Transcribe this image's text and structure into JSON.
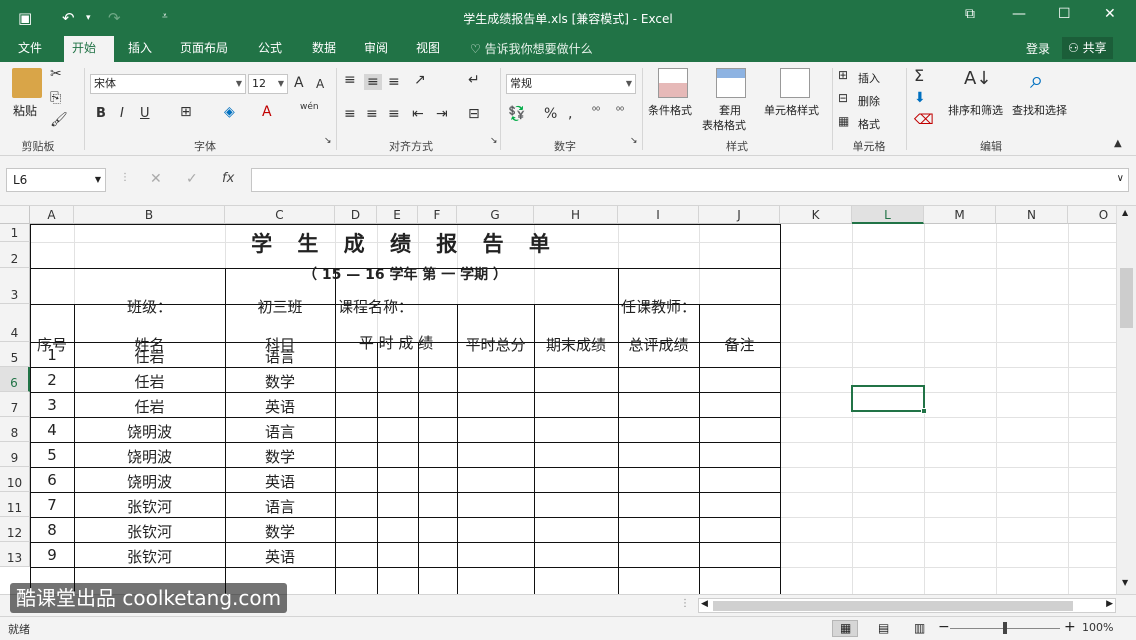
{
  "window": {
    "title": "学生成绩报告单.xls  [兼容模式] - Excel"
  },
  "tabs": {
    "file": "文件",
    "home": "开始",
    "insert": "插入",
    "page_layout": "页面布局",
    "formulas": "公式",
    "data": "数据",
    "review": "审阅",
    "view": "视图",
    "tell_me": "告诉我你想要做什么",
    "login": "登录",
    "share": "共享"
  },
  "ribbon": {
    "paste": "粘贴",
    "clipboard": "剪贴板",
    "font_name": "宋体",
    "font_size": "12",
    "font_group": "字体",
    "align_group": "对齐方式",
    "number_format": "常规",
    "number_group": "数字",
    "conditional_format": "条件格式",
    "format_table_1": "套用",
    "format_table_2": "表格格式",
    "cell_styles": "单元格样式",
    "styles_group": "样式",
    "insert": "插入",
    "delete": "删除",
    "format": "格式",
    "cells_group": "单元格",
    "sort_filter": "排序和筛选",
    "find_select": "查找和选择",
    "editing_group": "编辑",
    "bold": "B",
    "italic": "I",
    "underline": "U",
    "percent": "%",
    "wen": "wén"
  },
  "formula_bar": {
    "name_box": "L6",
    "fx": "fx",
    "cancel": "✕",
    "enter": "✓",
    "value": ""
  },
  "columns": [
    "A",
    "B",
    "C",
    "D",
    "E",
    "F",
    "G",
    "H",
    "I",
    "J",
    "K",
    "L",
    "M",
    "N",
    "O"
  ],
  "rows": [
    "1",
    "2",
    "3",
    "4",
    "5",
    "6",
    "7",
    "8",
    "9",
    "10",
    "11",
    "12",
    "13"
  ],
  "sheet": {
    "title": "学 生 成 绩 报 告 单",
    "subtitle": "（ 15 — 16   学年 第 一 学期 ）",
    "class_label": "班级：",
    "class_value": "初三班",
    "course_label": "课程名称：",
    "teacher_label": "任课教师：",
    "headers": [
      "序号",
      "姓名",
      "科目",
      "平 时 成 绩",
      "平时总分",
      "期末成绩",
      "总评成绩",
      "备注"
    ],
    "records": [
      {
        "no": "1",
        "name": "任岩",
        "subject": "语言"
      },
      {
        "no": "2",
        "name": "任岩",
        "subject": "数学"
      },
      {
        "no": "3",
        "name": "任岩",
        "subject": "英语"
      },
      {
        "no": "4",
        "name": "饶明波",
        "subject": "语言"
      },
      {
        "no": "5",
        "name": "饶明波",
        "subject": "数学"
      },
      {
        "no": "6",
        "name": "饶明波",
        "subject": "英语"
      },
      {
        "no": "7",
        "name": "张钦河",
        "subject": "语言"
      },
      {
        "no": "8",
        "name": "张钦河",
        "subject": "数学"
      },
      {
        "no": "9",
        "name": "张钦河",
        "subject": "英语"
      }
    ]
  },
  "status": {
    "ready": "就绪",
    "zoom": "100%",
    "zoom_minus": "−",
    "zoom_plus": "+"
  },
  "watermark": "酷课堂出品 coolketang.com",
  "colors": {
    "excel_green": "#217346",
    "ribbon_bg": "#f3f3f3"
  }
}
